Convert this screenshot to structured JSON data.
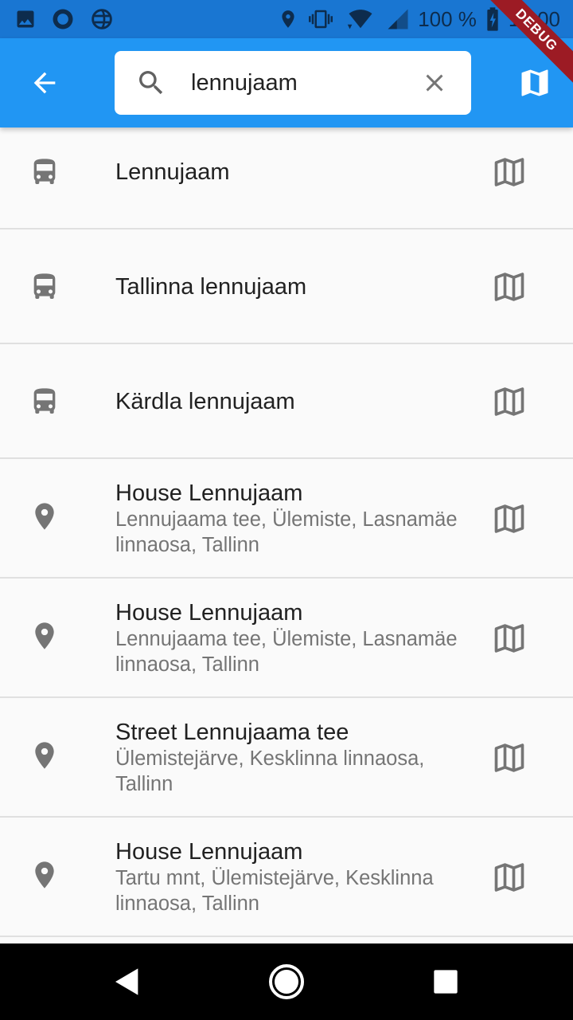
{
  "status_bar": {
    "battery": "100 %",
    "time": "12:00",
    "left_icons": [
      "image-icon",
      "circle-app-icon",
      "sync-globe-icon"
    ],
    "right_icons": [
      "location-icon",
      "vibrate-icon",
      "wifi-icon",
      "signal-icon",
      "battery-charging-icon"
    ]
  },
  "debug_banner": "DEBUG",
  "app_bar": {
    "back_icon": "arrow-back-icon",
    "search": {
      "value": "lennujaam",
      "icon": "search-icon",
      "clear_icon": "close-icon"
    },
    "map_icon": "map-icon"
  },
  "results": [
    {
      "type": "bus-stop",
      "icon": "bus-icon",
      "title": "Lennujaam",
      "subtitle": "",
      "action_icon": "map-outline-icon"
    },
    {
      "type": "bus-stop",
      "icon": "bus-icon",
      "title": "Tallinna lennujaam",
      "subtitle": "",
      "action_icon": "map-outline-icon"
    },
    {
      "type": "bus-stop",
      "icon": "bus-icon",
      "title": "Kärdla lennujaam",
      "subtitle": "",
      "action_icon": "map-outline-icon"
    },
    {
      "type": "place",
      "icon": "place-pin-icon",
      "title": "House Lennujaam",
      "subtitle": "Lennujaama tee, Ülemiste, Lasnamäe linnaosa, Tallinn",
      "action_icon": "map-outline-icon"
    },
    {
      "type": "place",
      "icon": "place-pin-icon",
      "title": "House Lennujaam",
      "subtitle": "Lennujaama tee, Ülemiste, Lasnamäe linnaosa, Tallinn",
      "action_icon": "map-outline-icon"
    },
    {
      "type": "place",
      "icon": "place-pin-icon",
      "title": "Street Lennujaama tee",
      "subtitle": "Ülemistejärve, Kesklinna linnaosa, Tallinn",
      "action_icon": "map-outline-icon"
    },
    {
      "type": "place",
      "icon": "place-pin-icon",
      "title": "House Lennujaam",
      "subtitle": "Tartu mnt, Ülemistejärve, Kesklinna linnaosa, Tallinn",
      "action_icon": "map-outline-icon"
    }
  ],
  "nav_bar": {
    "back": "nav-back-icon",
    "home": "nav-home-icon",
    "recents": "nav-recents-icon"
  },
  "colors": {
    "primary": "#2196f3",
    "status_bar": "#1976d2",
    "icon_grey": "#757575",
    "debug": "#9c1b24"
  }
}
